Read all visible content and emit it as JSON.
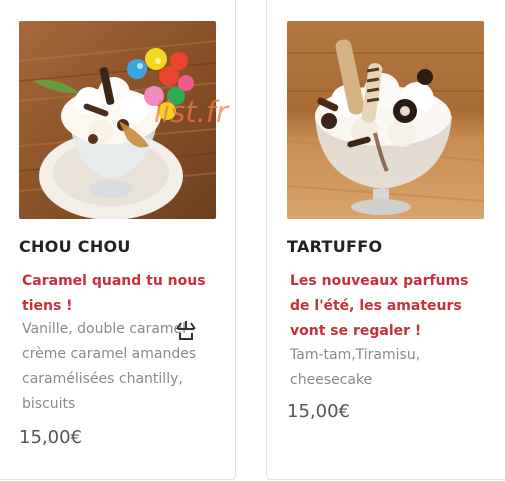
{
  "products": [
    {
      "name": "CHOU CHOU",
      "tagline": "Caramel quand tu nous tiens !",
      "description": "Vanille, double caramel crème caramel amandes caramélisées chantilly, biscuits",
      "price": "15,00€",
      "image_icon": "sundae-with-candy-balls"
    },
    {
      "name": "TARTUFFO",
      "tagline": "Les nouveaux parfums de l'été, les amateurs vont se regaler !",
      "description": "Tam-tam,Tiramisu, cheesecake",
      "price": "15,00€",
      "image_icon": "sundae-with-wafer-rolls"
    }
  ],
  "watermark": "list.fr",
  "colors": {
    "tagline": "#c8303a",
    "name": "#222222",
    "description": "#8a8a8a",
    "price": "#555555",
    "card_border": "#e3e3e3",
    "watermark": "#f27846"
  }
}
